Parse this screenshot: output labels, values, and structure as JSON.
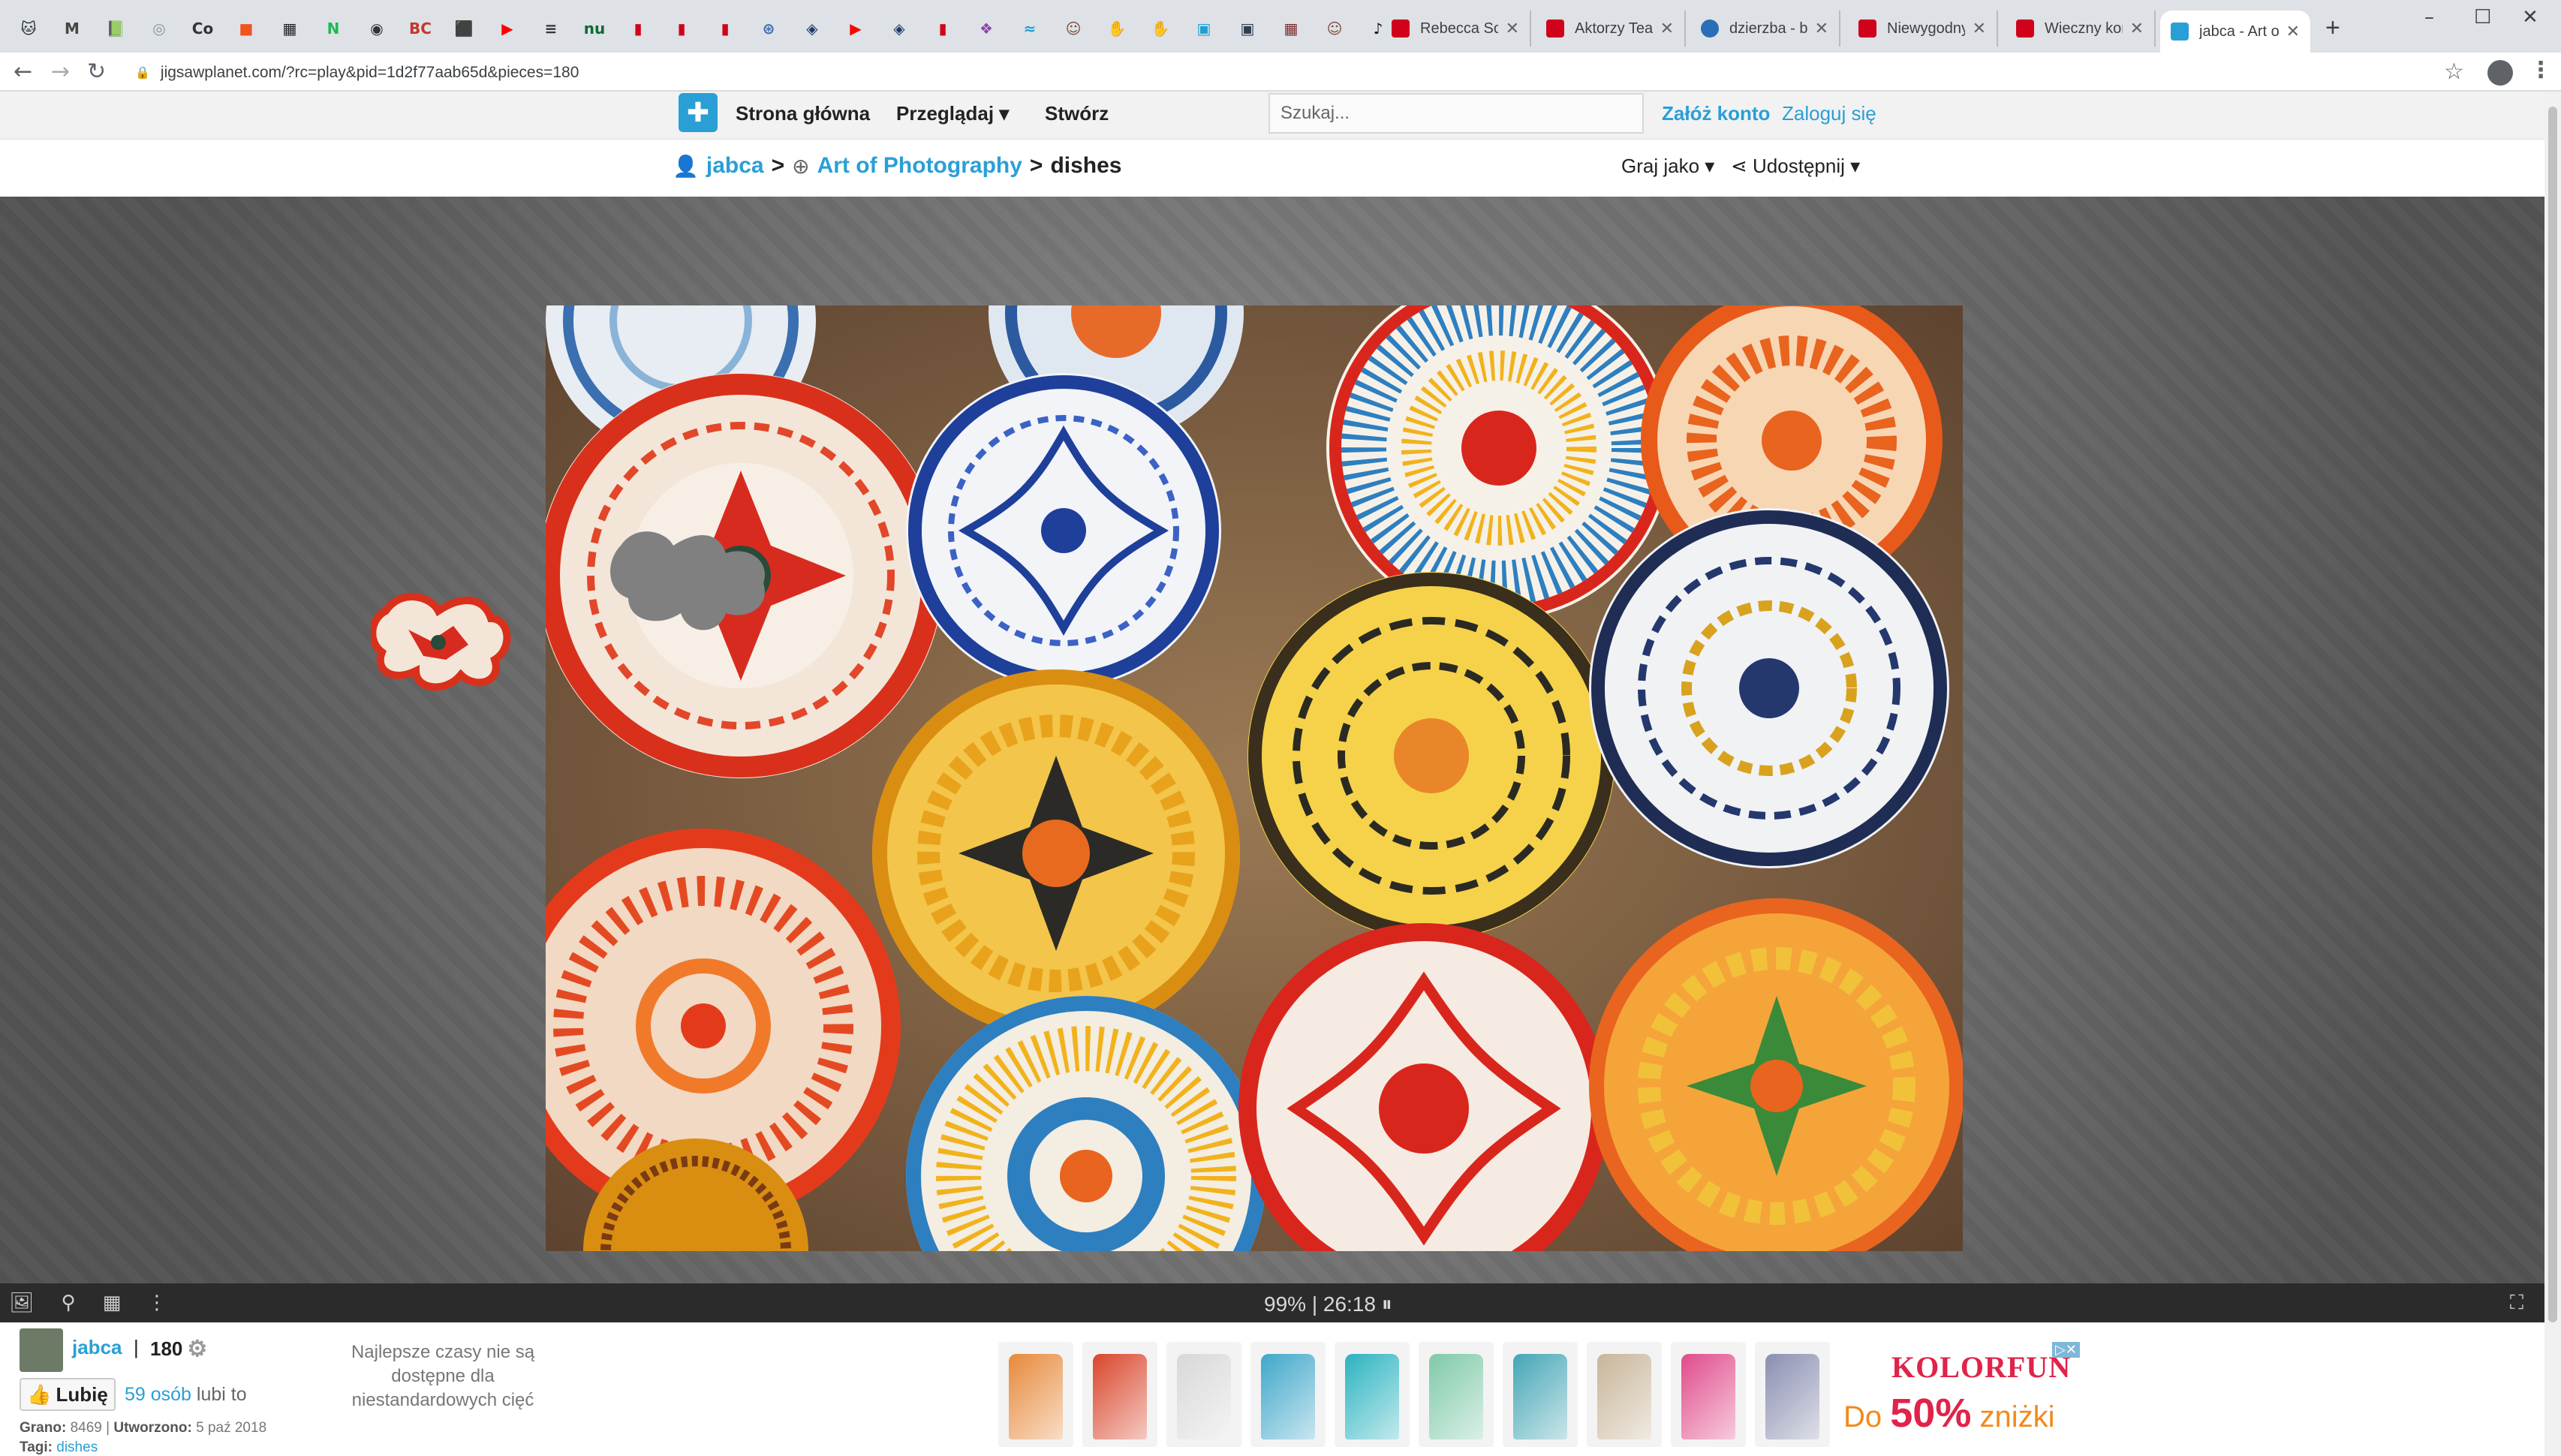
{
  "browser": {
    "pinned_tabs": [
      {
        "icon": "github-icon",
        "glyph": "🐱",
        "color": "#24292e"
      },
      {
        "icon": "gmail-icon",
        "glyph": "M",
        "color": "#444444"
      },
      {
        "icon": "green-book-icon",
        "glyph": "📗",
        "color": "#6a8f3a"
      },
      {
        "icon": "grey-circle-icon",
        "glyph": "◎",
        "color": "#8a9a8a"
      },
      {
        "icon": "co-icon",
        "glyph": "Co",
        "color": "#333333"
      },
      {
        "icon": "orange-app-icon",
        "glyph": "■",
        "color": "#f0541e"
      },
      {
        "icon": "mail-grid-icon",
        "glyph": "▦",
        "color": "#222222"
      },
      {
        "icon": "n-green-icon",
        "glyph": "N",
        "color": "#1db954"
      },
      {
        "icon": "pocket-icon",
        "glyph": "◉",
        "color": "#333333"
      },
      {
        "icon": "bc-icon",
        "glyph": "BC",
        "color": "#c0392b"
      },
      {
        "icon": "box-icon",
        "glyph": "⬛",
        "color": "#444444"
      },
      {
        "icon": "youtube-icon",
        "glyph": "▶",
        "color": "#ff0000"
      },
      {
        "icon": "tvn-icon",
        "glyph": "≡",
        "color": "#333333"
      },
      {
        "icon": "nu-icon",
        "glyph": "nu",
        "color": "#0d6b2f"
      },
      {
        "icon": "red-doc-icon",
        "glyph": "▮",
        "color": "#d0021b"
      },
      {
        "icon": "red-doc-icon",
        "glyph": "▮",
        "color": "#d0021b"
      },
      {
        "icon": "red-doc-icon",
        "glyph": "▮",
        "color": "#d0021b"
      },
      {
        "icon": "globe-icon",
        "glyph": "⊛",
        "color": "#3b6cb5"
      },
      {
        "icon": "blue-square-icon",
        "glyph": "◈",
        "color": "#1f3b6b"
      },
      {
        "icon": "youtube-icon",
        "glyph": "▶",
        "color": "#ff0000"
      },
      {
        "icon": "blue-square-icon",
        "glyph": "◈",
        "color": "#1f3b6b"
      },
      {
        "icon": "red-doc-icon",
        "glyph": "▮",
        "color": "#d0021b"
      },
      {
        "icon": "purple-flower-icon",
        "glyph": "❖",
        "color": "#8e44ad"
      },
      {
        "icon": "cyan-app-icon",
        "glyph": "≈",
        "color": "#1ca0d2"
      },
      {
        "icon": "face-icon",
        "glyph": "☺",
        "color": "#7a4a3a"
      },
      {
        "icon": "yellow-hand-icon",
        "glyph": "✋",
        "color": "#d4a017"
      },
      {
        "icon": "yellow-hand-icon",
        "glyph": "✋",
        "color": "#d4a017"
      },
      {
        "icon": "cyan-box-icon",
        "glyph": "▣",
        "color": "#1ca0d2"
      },
      {
        "icon": "dark-box-icon",
        "glyph": "▣",
        "color": "#2d3e50"
      },
      {
        "icon": "photo-grid-icon",
        "glyph": "▦",
        "color": "#7a2e2e"
      },
      {
        "icon": "face-icon",
        "glyph": "☺",
        "color": "#7a4a3a"
      },
      {
        "icon": "tiktok-icon",
        "glyph": "♪",
        "color": "#111111"
      }
    ],
    "named_tabs": [
      {
        "title": "Rebecca Solnit",
        "fav": "#d0021b",
        "icon": "red-doc-icon"
      },
      {
        "title": "Aktorzy Teatru",
        "fav": "#d0021b",
        "icon": "red-doc-icon"
      },
      {
        "title": "dzierzba - blog",
        "fav": "#2a6fb5",
        "icon": "blog-icon"
      },
      {
        "title": "Niewygodny",
        "fav": "#d0021b",
        "icon": "p-icon"
      },
      {
        "title": "Wieczny konflikt",
        "fav": "#d0021b",
        "icon": "p-icon"
      },
      {
        "title": "jabca - Art of",
        "fav": "#2a9fd6",
        "icon": "jigsaw-icon"
      }
    ],
    "new_tab": "+",
    "url": "jigsawplanet.com/?rc=play&pid=1d2f77aab65d&pieces=180"
  },
  "site": {
    "logo_glyph": "✚",
    "nav": {
      "home": "Strona główna",
      "browse": "Przeglądaj",
      "create": "Stwórz"
    },
    "search_placeholder": "Szukaj...",
    "signup": "Załóż konto",
    "login": "Zaloguj się"
  },
  "breadcrumb": {
    "user": "jabca",
    "album": "Art of Photography",
    "separator": ">",
    "current": "dishes",
    "play_as": "Graj jako",
    "share": "Udostępnij"
  },
  "puzzle": {
    "progress": "99% | 26:18"
  },
  "footer": {
    "author": "jabca",
    "pipe": "|",
    "pieces": "180",
    "like": "Lubię",
    "likes_count": "59 osób",
    "likes_suffix": "lubi to",
    "played_label": "Grano:",
    "played_value": "8469",
    "created_label": "Utworzono:",
    "created_value": "5 paź 2018",
    "tags_label": "Tagi:",
    "tag": "dishes",
    "best_times": "Najlepsze czasy nie są dostępne dla niestandardowych cięć"
  },
  "ad": {
    "brand": "KOLORFUN",
    "promo_prefix": "Do",
    "promo_value": "50%",
    "promo_suffix": "zniżki",
    "shirt_colors": [
      "#e7893a",
      "#d9452b",
      "#d8d8d8",
      "#3fa7c9",
      "#2bb3c0",
      "#7fc9a8",
      "#44a6b5",
      "#c8b59a",
      "#e04a8a",
      "#8a8fb0"
    ]
  }
}
